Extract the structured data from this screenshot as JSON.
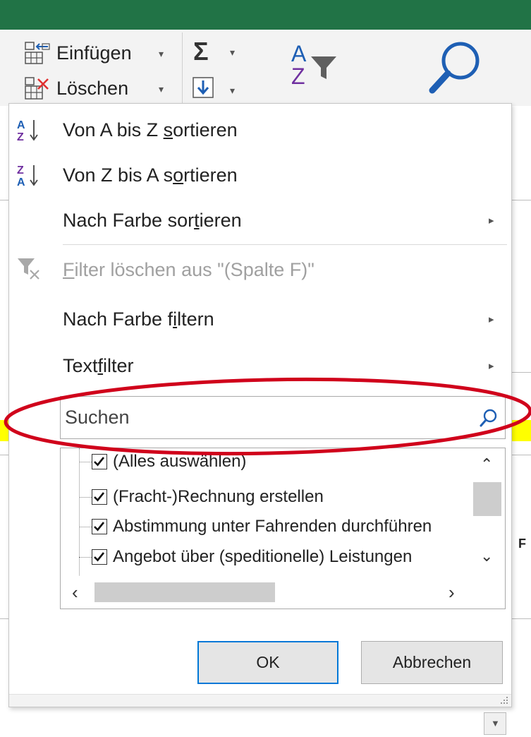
{
  "colors": {
    "excel_green": "#217346",
    "ribbon_bg": "#f3f3f3",
    "sigma_blue": "#1e5fb4",
    "highlight_red": "#d0021b",
    "default_button_border": "#0078d7"
  },
  "ribbon": {
    "insert_label": "Einfügen",
    "delete_label": "Löschen",
    "sigma_symbol": "Σ",
    "sort_filter_letters": {
      "a": "A",
      "z": "Z"
    }
  },
  "menu": {
    "sort_az": {
      "before": "Von A bis Z ",
      "accel": "s",
      "after": "ortieren"
    },
    "sort_za": {
      "before": "Von Z bis A s",
      "accel": "o",
      "after": "rtieren"
    },
    "sort_by_color": {
      "before": "Nach Farbe sor",
      "accel": "t",
      "after": "ieren"
    },
    "clear_filter": {
      "before": "",
      "accel": "F",
      "after": "ilter löschen aus \"(Spalte F)\""
    },
    "filter_by_color": {
      "before": "Nach Farbe f",
      "accel": "i",
      "after": "ltern"
    },
    "text_filter": {
      "before": "Text",
      "accel": "f",
      "after": "ilter"
    }
  },
  "search": {
    "placeholder": "Suchen"
  },
  "list": {
    "items": [
      {
        "label": "(Alles auswählen)",
        "checked": true
      },
      {
        "label": "(Fracht-)Rechnung erstellen",
        "checked": true
      },
      {
        "label": "Abstimmung unter Fahrenden durchführen",
        "checked": true
      },
      {
        "label": "Angebot über (speditionelle) Leistungen",
        "checked": true
      }
    ]
  },
  "buttons": {
    "ok": "OK",
    "cancel": "Abbrechen"
  },
  "sheet_partial_text": "F"
}
